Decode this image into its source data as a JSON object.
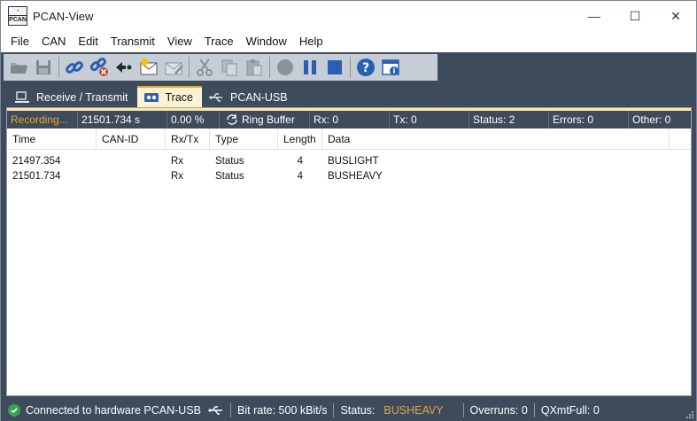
{
  "window": {
    "title": "PCAN-View",
    "minimize": "—",
    "maximize": "☐",
    "close": "✕",
    "app_icon_text": "PCAN"
  },
  "menu": {
    "items": [
      "File",
      "CAN",
      "Edit",
      "Transmit",
      "View",
      "Trace",
      "Window",
      "Help"
    ]
  },
  "toolbar": {
    "buttons": [
      "open-folder-icon",
      "save-icon",
      "connect-icon",
      "disconnect-icon",
      "reset-icon",
      "new-message-icon",
      "edit-message-icon",
      "cut-icon",
      "copy-icon",
      "paste-icon",
      "record-icon",
      "pause-icon",
      "stop-icon",
      "help-icon",
      "about-icon"
    ]
  },
  "tabs": [
    {
      "label": "Receive / Transmit",
      "icon": "network-icon",
      "active": false
    },
    {
      "label": "Trace",
      "icon": "tape-icon",
      "active": true
    },
    {
      "label": "PCAN-USB",
      "icon": "usb-icon",
      "active": false
    }
  ],
  "trace_status": {
    "recording": "Recording...",
    "time": "21501.734 s",
    "fill": "0.00 %",
    "buffer_mode": "Ring Buffer",
    "rx": "Rx: 0",
    "tx": "Tx: 0",
    "status": "Status: 2",
    "errors": "Errors: 0",
    "other": "Other: 0"
  },
  "table": {
    "columns": [
      "Time",
      "CAN-ID",
      "Rx/Tx",
      "Type",
      "Length",
      "Data"
    ],
    "rows": [
      {
        "time": "21497.354",
        "can_id": "",
        "rxtx": "Rx",
        "type": "Status",
        "length": "4",
        "data": "BUSLIGHT"
      },
      {
        "time": "21501.734",
        "can_id": "",
        "rxtx": "Rx",
        "type": "Status",
        "length": "4",
        "data": "BUSHEAVY"
      }
    ]
  },
  "statusbar": {
    "connection": "Connected to hardware PCAN-USB",
    "bitrate": "Bit rate: 500 kBit/s",
    "status_label": "Status:",
    "status_value": "BUSHEAVY",
    "overruns": "Overruns: 0",
    "qxmtfull": "QXmtFull: 0"
  },
  "colors": {
    "accent": "#e8a53a",
    "chrome": "#3d4b5c",
    "ok": "#35a352"
  }
}
